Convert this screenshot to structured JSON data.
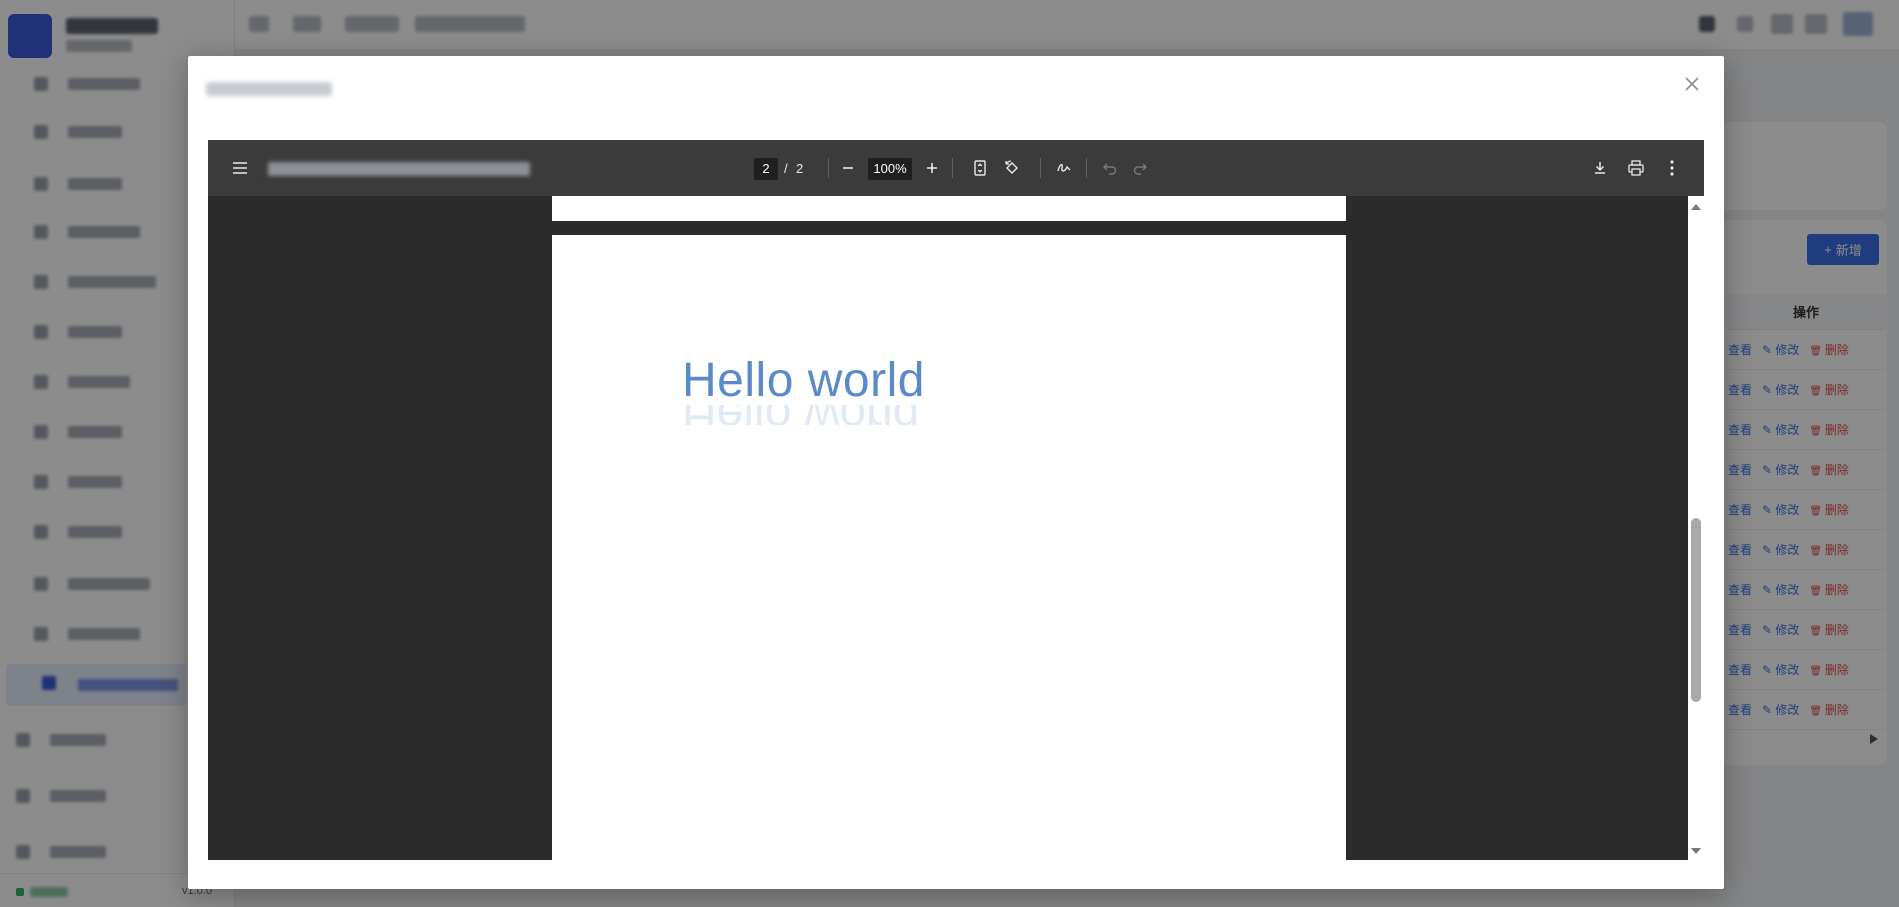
{
  "app": {
    "version": "v1.0.0",
    "add_button_label": "新增",
    "table": {
      "action_column_header": "操作",
      "rows": [
        {
          "view": "查看",
          "edit": "修改",
          "delete": "删除"
        },
        {
          "view": "查看",
          "edit": "修改",
          "delete": "删除"
        },
        {
          "view": "查看",
          "edit": "修改",
          "delete": "删除"
        },
        {
          "view": "查看",
          "edit": "修改",
          "delete": "删除"
        },
        {
          "view": "查看",
          "edit": "修改",
          "delete": "删除"
        },
        {
          "view": "查看",
          "edit": "修改",
          "delete": "删除"
        },
        {
          "view": "查看",
          "edit": "修改",
          "delete": "删除"
        },
        {
          "view": "查看",
          "edit": "修改",
          "delete": "删除"
        },
        {
          "view": "查看",
          "edit": "修改",
          "delete": "删除"
        },
        {
          "view": "查看",
          "edit": "修改",
          "delete": "删除"
        }
      ]
    }
  },
  "modal": {
    "close_icon": "close-icon"
  },
  "pdf_viewer": {
    "current_page": "2",
    "page_separator": "/",
    "total_pages": "2",
    "zoom": "100%",
    "page_content": {
      "heading": "Hello world"
    },
    "icons": [
      "menu-icon",
      "zoom-out-icon",
      "zoom-in-icon",
      "fit-page-icon",
      "rotate-icon",
      "annotate-icon",
      "undo-icon",
      "redo-icon",
      "download-icon",
      "print-icon",
      "more-icon"
    ]
  },
  "colors": {
    "accent": "#3a6fe6",
    "danger": "#e04b4b",
    "toolbar": "#3b3b3b",
    "viewer_bg": "#2b2b2b",
    "heading_text": "#5b8ac9"
  }
}
